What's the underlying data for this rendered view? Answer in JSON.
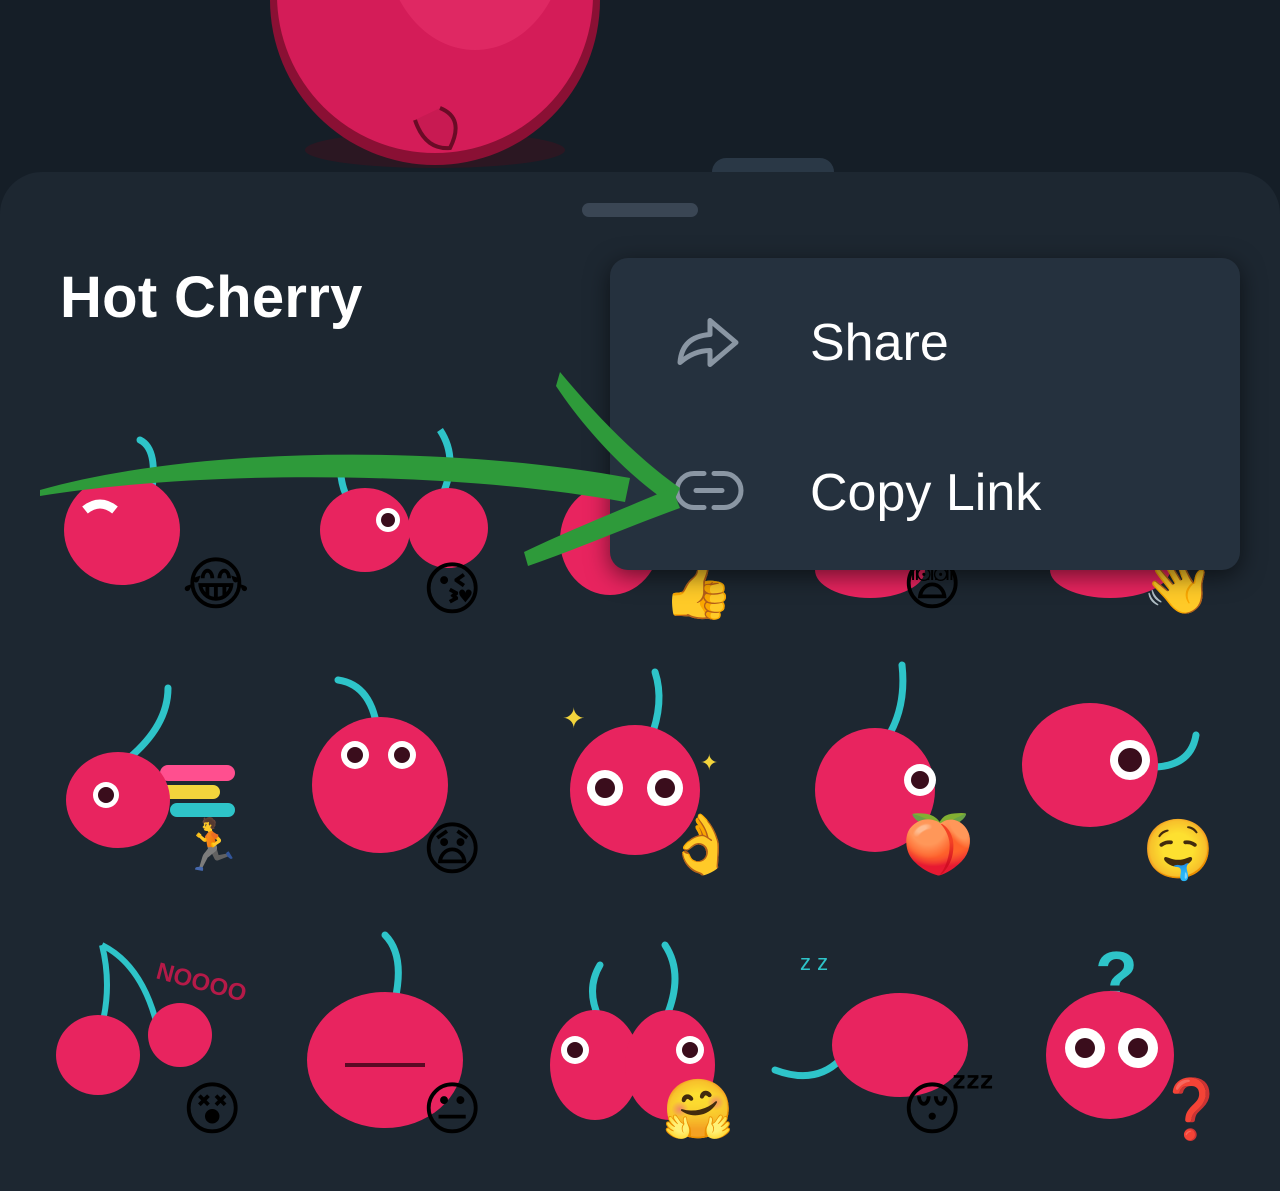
{
  "sheet": {
    "title": "Hot Cherry"
  },
  "menu": {
    "items": [
      {
        "label": "Share",
        "icon": "share-icon"
      },
      {
        "label": "Copy Link",
        "icon": "link-icon"
      }
    ]
  },
  "stickers": {
    "row1": [
      "😂",
      "😘",
      "👍",
      "😨",
      "👋"
    ],
    "row2": [
      "🏃",
      "😧",
      "👌",
      "🍑",
      "🤤"
    ],
    "row3": [
      "😵",
      "😐",
      "🤗",
      "😴",
      "❓"
    ]
  },
  "colors": {
    "sheet_bg": "#1d2731",
    "menu_bg": "#25313e",
    "cherry": "#e8245f",
    "stem": "#2ec4c9",
    "annotation": "#2e9a3a"
  }
}
